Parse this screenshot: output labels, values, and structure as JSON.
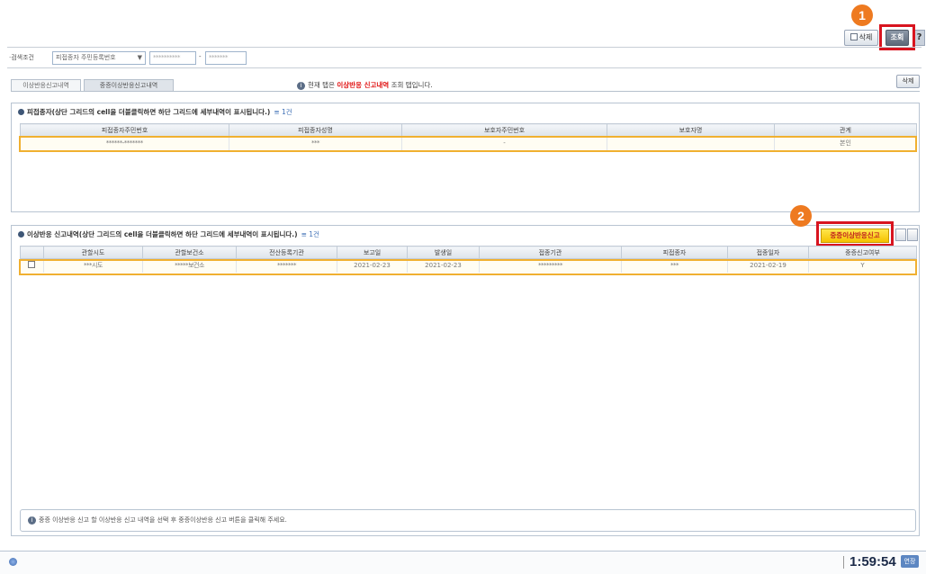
{
  "toolbar": {
    "delete_label": "삭제",
    "search_label": "조회",
    "help_label": "?",
    "marker1": "1",
    "marker2": "2"
  },
  "search": {
    "label": "·검색조건",
    "type_value": "피접종자 주민등록번호",
    "field1": "**********",
    "separator": "-",
    "field2": "*******"
  },
  "tabs": [
    {
      "label": "이상반응신고내역"
    },
    {
      "label": "중증이상반응신고내역"
    }
  ],
  "notice": {
    "prefix": "현재 탭은",
    "highlight": "이상반응 신고내역",
    "suffix": "조회 탭입니다."
  },
  "right_delete_label": "삭제",
  "panel1": {
    "title": "피접종자(상단 그리드의 cell을 더블클릭하면 하단 그리드에 세부내역이 표시됩니다.)",
    "count": "1건",
    "columns": [
      "피접종자주민번호",
      "피접종자성명",
      "보호자주민번호",
      "보호자명",
      "관계"
    ],
    "rows": [
      [
        "******-*******",
        "***",
        "-",
        "",
        "본인"
      ]
    ]
  },
  "panel2": {
    "title": "이상반응 신고내역(상단 그리드의 cell을 더블클릭하면 하단 그리드에 세부내역이 표시됩니다.)",
    "count": "1건",
    "button_label": "중증이상반응신고",
    "columns": [
      "",
      "관할시도",
      "관할보건소",
      "전산등록기관",
      "보고일",
      "발생일",
      "접종기관",
      "피접종자",
      "접종일자",
      "중증신고여부"
    ],
    "rows": [
      [
        "",
        "***시도",
        "*****보건소",
        "*******",
        "2021-02-23",
        "2021-02-23",
        "*********",
        "***",
        "2021-02-19",
        "Y"
      ]
    ]
  },
  "footer_note": "중증 이상반응 신고 할 이상반응 신고 내역을 선택 후 중증이상반응 신고 버튼을 클릭해 주세요.",
  "status": {
    "clock": "1:59:54",
    "extend_label": "연장"
  }
}
